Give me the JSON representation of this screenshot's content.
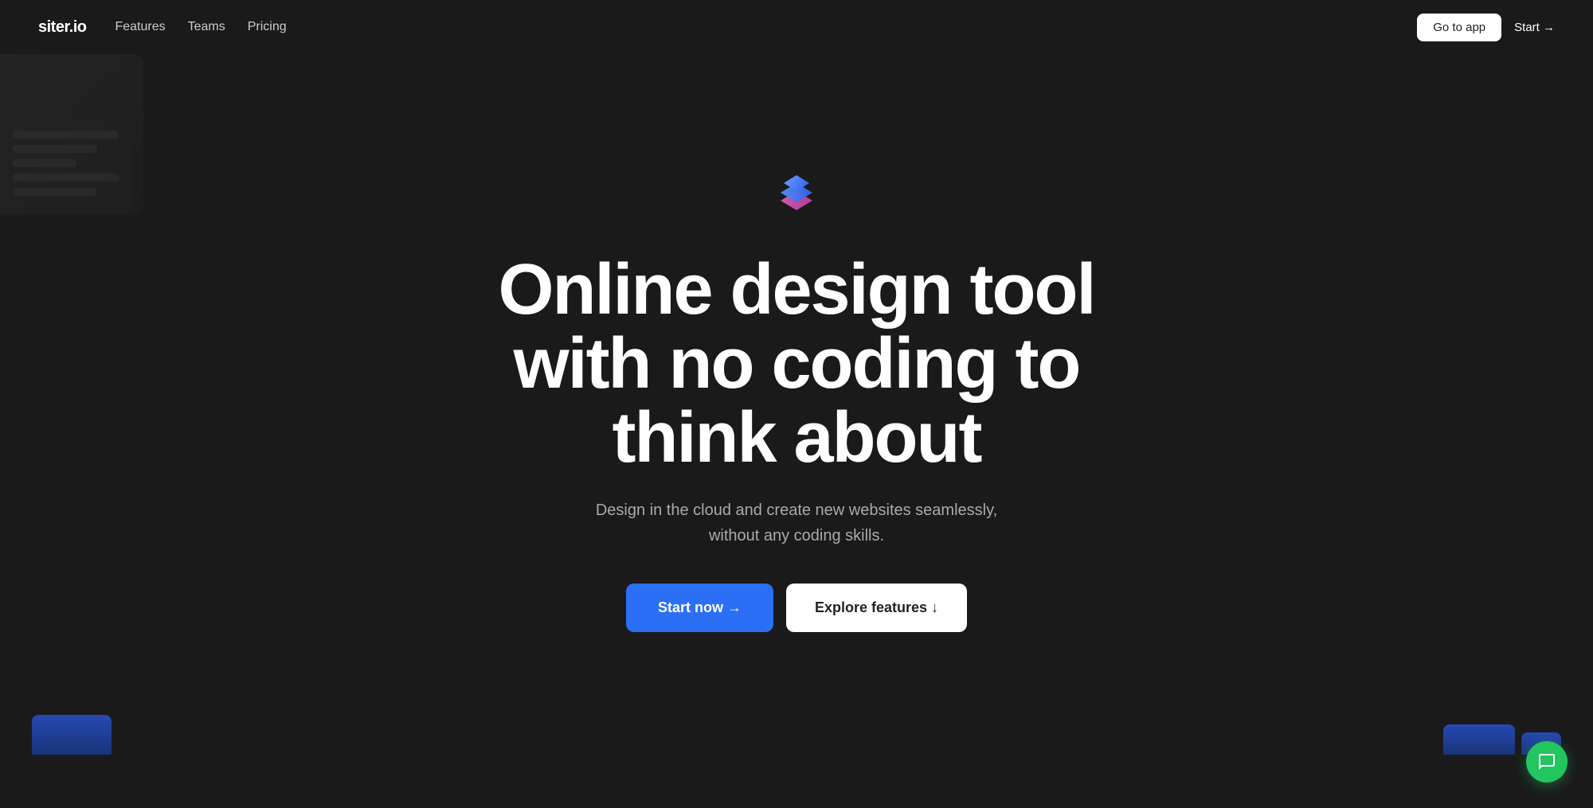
{
  "nav": {
    "logo": "siter.io",
    "links": [
      {
        "id": "features",
        "label": "Features"
      },
      {
        "id": "teams",
        "label": "Teams"
      },
      {
        "id": "pricing",
        "label": "Pricing"
      }
    ],
    "go_to_app_label": "Go to app",
    "start_label": "Start →"
  },
  "hero": {
    "title": "Online design tool with no coding to think about",
    "subtitle": "Design in the cloud and create new websites seamlessly, without any coding skills.",
    "start_now_label": "Start now →",
    "explore_features_label": "Explore features ↓"
  },
  "chat": {
    "icon": "💬"
  }
}
